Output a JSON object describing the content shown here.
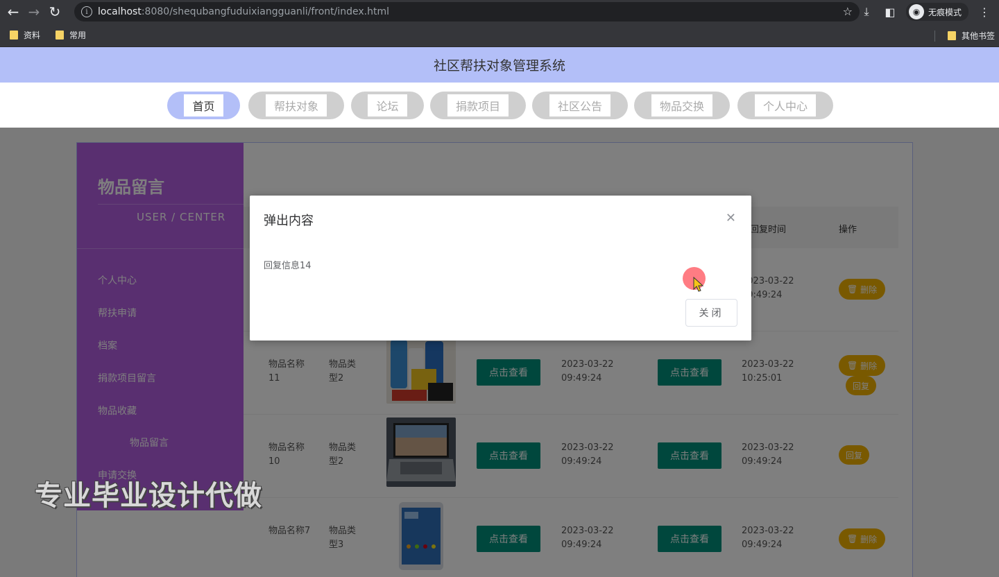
{
  "browser": {
    "url_host": "localhost",
    "url_rest": ":8080/shequbangfuduixiangguanli/front/index.html",
    "incognito_label": "无痕模式",
    "bookmarks": [
      {
        "label": "资料"
      },
      {
        "label": "常用"
      }
    ],
    "other_bookmarks": "其他书签"
  },
  "site": {
    "title": "社区帮扶对象管理系统",
    "nav": [
      {
        "label": "首页",
        "active": true
      },
      {
        "label": "帮扶对象"
      },
      {
        "label": "论坛"
      },
      {
        "label": "捐款项目"
      },
      {
        "label": "社区公告"
      },
      {
        "label": "物品交换"
      },
      {
        "label": "个人中心"
      }
    ]
  },
  "sidebar": {
    "title": "物品留言",
    "subtitle": "USER / CENTER",
    "items": [
      {
        "label": "个人中心"
      },
      {
        "label": "帮扶申请"
      },
      {
        "label": "档案"
      },
      {
        "label": "捐款项目留言"
      },
      {
        "label": "物品收藏"
      },
      {
        "label": "物品留言"
      },
      {
        "label": "申请交换"
      }
    ]
  },
  "table": {
    "headers": {
      "reply_time": "回复时间",
      "actions": "操作"
    },
    "rows": [
      {
        "name": "",
        "type": "",
        "btn1": "",
        "time1": "",
        "btn2": "",
        "time2": "2023-03-22 09:49:24",
        "actions": [
          "删除"
        ]
      },
      {
        "name": "物品名称11",
        "type": "物品类型2",
        "btn1": "点击查看",
        "time1": "2023-03-22 09:49:24",
        "btn2": "点击查看",
        "time2": "2023-03-22 10:25:01",
        "actions": [
          "删除",
          "回复"
        ]
      },
      {
        "name": "物品名称10",
        "type": "物品类型2",
        "btn1": "点击查看",
        "time1": "2023-03-22 09:49:24",
        "btn2": "点击查看",
        "time2": "2023-03-22 09:49:24",
        "actions": [
          "回复"
        ]
      },
      {
        "name": "物品名称7",
        "type": "物品类型3",
        "btn1": "点击查看",
        "time1": "2023-03-22 09:49:24",
        "btn2": "点击查看",
        "time2": "2023-03-22 09:49:24",
        "actions": [
          "删除"
        ]
      }
    ]
  },
  "dialog": {
    "title": "弹出内容",
    "body": "回复信息14",
    "close_button": "关闭"
  },
  "watermark": "专业毕业设计代做"
}
